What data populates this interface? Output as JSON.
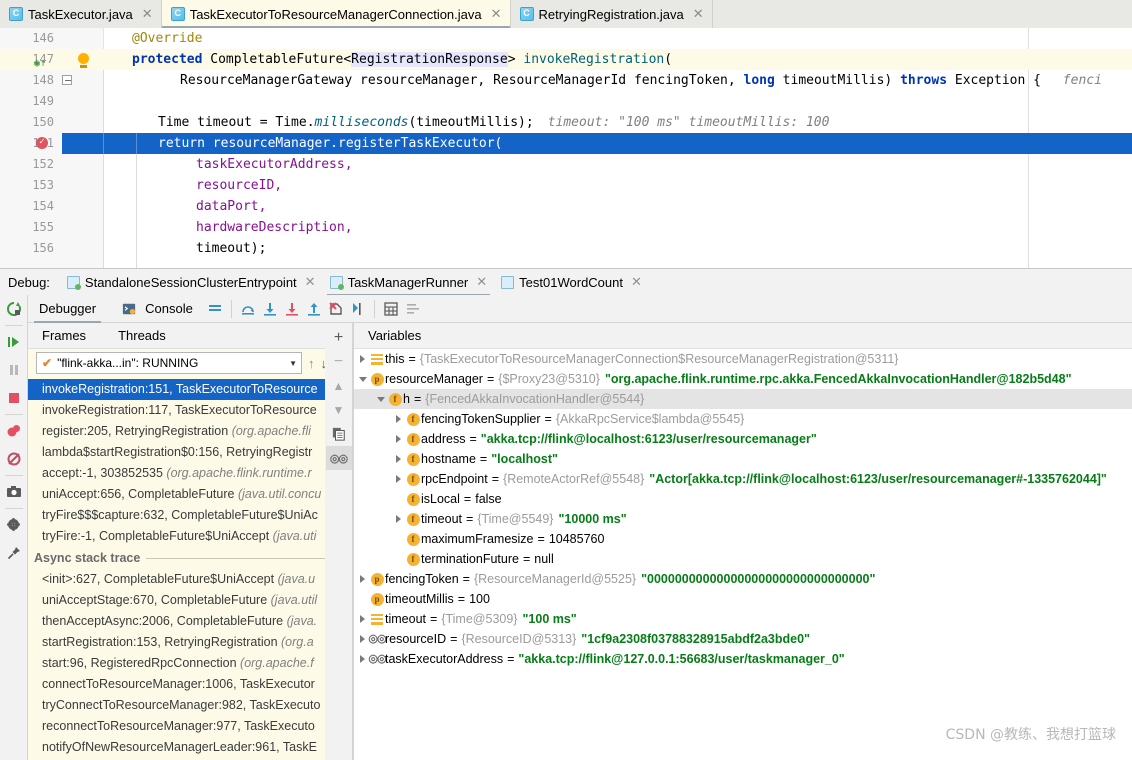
{
  "editor": {
    "tabs": [
      {
        "label": "TaskExecutor.java",
        "icon": "java-class-icon",
        "active": false,
        "close": "✕"
      },
      {
        "label": "TaskExecutorToResourceManagerConnection.java",
        "icon": "java-class-icon",
        "active": true,
        "close": "✕"
      },
      {
        "label": "RetryingRegistration.java",
        "icon": "java-class-icon",
        "active": false,
        "close": "✕"
      }
    ],
    "lines": [
      {
        "num": "146",
        "highlight": false,
        "selected": false
      },
      {
        "num": "147",
        "highlight": true,
        "selected": false
      },
      {
        "num": "148",
        "highlight": false,
        "selected": false
      },
      {
        "num": "149",
        "highlight": false,
        "selected": false
      },
      {
        "num": "150",
        "highlight": false,
        "selected": false
      },
      {
        "num": "151",
        "highlight": false,
        "selected": true
      },
      {
        "num": "152",
        "highlight": false,
        "selected": false
      },
      {
        "num": "153",
        "highlight": false,
        "selected": false
      },
      {
        "num": "154",
        "highlight": false,
        "selected": false
      },
      {
        "num": "155",
        "highlight": false,
        "selected": false
      },
      {
        "num": "156",
        "highlight": false,
        "selected": false
      }
    ],
    "code": {
      "l146_annotation": "@Override",
      "l147_kw": "protected",
      "l147_type": "CompletableFuture<",
      "l147_generic": "RegistrationResponse",
      "l147_gt": "> ",
      "l147_method": "invokeRegistration",
      "l147_paren": "(",
      "l148_p1": "ResourceManagerGateway resourceManager, ResourceManagerId fencingToken, ",
      "l148_kw": "long",
      "l148_p2": " timeoutMillis) ",
      "l148_throws": "throws",
      "l148_p3": " Exception { ",
      "l148_hint": "fenci",
      "l150_a": "Time timeout = Time.",
      "l150_m": "milliseconds",
      "l150_b": "(timeoutMillis);",
      "l150_hint": "timeout: \"100 ms\"  timeoutMillis: 100",
      "l151": "return resourceManager.registerTaskExecutor(",
      "l152": "taskExecutorAddress,",
      "l153": "resourceID,",
      "l154": "dataPort,",
      "l155": "hardwareDescription,",
      "l156": "timeout);"
    }
  },
  "debug": {
    "label": "Debug:",
    "session_tabs": [
      {
        "label": "StandaloneSessionClusterEntrypoint",
        "active": false,
        "running": true,
        "close": "✕"
      },
      {
        "label": "TaskManagerRunner",
        "active": true,
        "running": true,
        "close": "✕"
      },
      {
        "label": "Test01WordCount",
        "active": false,
        "running": false,
        "close": "✕"
      }
    ],
    "toolbar_tabs": [
      {
        "label": "Debugger",
        "icon": "debugger-icon",
        "active": true
      },
      {
        "label": "Console",
        "icon": "console-icon",
        "active": false
      }
    ],
    "rail_icons": [
      "rerun-icon",
      "resume-program-icon",
      "pause-program-icon",
      "stop-icon",
      "mute-breakpoints-icon",
      "view-breakpoints-icon",
      "camera-icon",
      "settings-icon",
      "pin-icon"
    ],
    "step_icons": [
      "layout-icon",
      "step-over-icon",
      "step-into-icon",
      "force-step-into-icon",
      "step-out-icon",
      "drop-frame-icon",
      "run-to-cursor-icon",
      "evaluate-expression-icon",
      "show-execution-point-icon"
    ]
  },
  "frames": {
    "header_tabs": [
      {
        "label": "Frames",
        "active": true
      },
      {
        "label": "Threads",
        "active": false
      }
    ],
    "thread_selector": {
      "value": "\"flink-akka...in\": RUNNING",
      "status_icon": "check-icon",
      "chevron": "▼"
    },
    "toolbar_icons": [
      "arrow-up-icon",
      "arrow-down-icon",
      "filter-icon"
    ],
    "side_icons": [
      "add-icon",
      "remove-icon",
      "move-up-icon",
      "move-down-icon",
      "copy-icon",
      "watches-icon"
    ],
    "items": [
      {
        "text": "invokeRegistration:151, TaskExecutorToResource",
        "pkg": "",
        "selected": true
      },
      {
        "text": "invokeRegistration:117, TaskExecutorToResource",
        "pkg": "",
        "selected": false
      },
      {
        "text": "register:205, RetryingRegistration ",
        "pkg": "(org.apache.fli",
        "selected": false
      },
      {
        "text": "lambda$startRegistration$0:156, RetryingRegistr",
        "pkg": "",
        "selected": false
      },
      {
        "text": "accept:-1, 303852535 ",
        "pkg": "(org.apache.flink.runtime.r",
        "selected": false
      },
      {
        "text": "uniAccept:656, CompletableFuture ",
        "pkg": "(java.util.concu",
        "selected": false
      },
      {
        "text": "tryFire$$$capture:632, CompletableFuture$UniAc",
        "pkg": "",
        "selected": false
      },
      {
        "text": "tryFire:-1, CompletableFuture$UniAccept ",
        "pkg": "(java.uti",
        "selected": false
      }
    ],
    "async_header": "Async stack trace",
    "async_items": [
      {
        "text": "<init>:627, CompletableFuture$UniAccept ",
        "pkg": "(java.u"
      },
      {
        "text": "uniAcceptStage:670, CompletableFuture ",
        "pkg": "(java.util"
      },
      {
        "text": "thenAcceptAsync:2006, CompletableFuture ",
        "pkg": "(java."
      },
      {
        "text": "startRegistration:153, RetryingRegistration ",
        "pkg": "(org.a"
      },
      {
        "text": "start:96, RegisteredRpcConnection ",
        "pkg": "(org.apache.f"
      },
      {
        "text": "connectToResourceManager:1006, TaskExecutor",
        "pkg": ""
      },
      {
        "text": "tryConnectToResourceManager:982, TaskExecuto",
        "pkg": ""
      },
      {
        "text": "reconnectToResourceManager:977, TaskExecuto",
        "pkg": ""
      },
      {
        "text": "notifyOfNewResourceManagerLeader:961, TaskE",
        "pkg": ""
      }
    ]
  },
  "variables": {
    "header": "Variables",
    "rows": [
      {
        "indent": 0,
        "arrow": "right",
        "icon": "list-badge",
        "highlight": false,
        "name": "this",
        "eq": "=",
        "type": "{TaskExecutorToResourceManagerConnection$ResourceManagerRegistration@5311}",
        "value": "",
        "value_kind": ""
      },
      {
        "indent": 0,
        "arrow": "down",
        "icon": "p-badge",
        "highlight": false,
        "name": "resourceManager",
        "eq": "=",
        "type": "{$Proxy23@5310}",
        "value": "\"org.apache.flink.runtime.rpc.akka.FencedAkkaInvocationHandler@182b5d48\"",
        "value_kind": "string"
      },
      {
        "indent": 1,
        "arrow": "down",
        "icon": "f-badge",
        "highlight": true,
        "name": "h",
        "eq": "=",
        "type": "{FencedAkkaInvocationHandler@5544}",
        "value": "",
        "value_kind": ""
      },
      {
        "indent": 2,
        "arrow": "right",
        "icon": "f-badge",
        "highlight": false,
        "name": "fencingTokenSupplier",
        "eq": "=",
        "type": "{AkkaRpcService$lambda@5545}",
        "value": "",
        "value_kind": ""
      },
      {
        "indent": 2,
        "arrow": "right",
        "icon": "f-badge",
        "highlight": false,
        "name": "address",
        "eq": "=",
        "type": "",
        "value": "\"akka.tcp://flink@localhost:6123/user/resourcemanager\"",
        "value_kind": "string"
      },
      {
        "indent": 2,
        "arrow": "right",
        "icon": "f-badge",
        "highlight": false,
        "name": "hostname",
        "eq": "=",
        "type": "",
        "value": "\"localhost\"",
        "value_kind": "string"
      },
      {
        "indent": 2,
        "arrow": "right",
        "icon": "f-badge",
        "highlight": false,
        "name": "rpcEndpoint",
        "eq": "=",
        "type": "{RemoteActorRef@5548}",
        "value": "\"Actor[akka.tcp://flink@localhost:6123/user/resourcemanager#-1335762044]\"",
        "value_kind": "string"
      },
      {
        "indent": 2,
        "arrow": "none",
        "icon": "f-badge",
        "highlight": false,
        "name": "isLocal",
        "eq": "=",
        "type": "",
        "value": "false",
        "value_kind": "keyword"
      },
      {
        "indent": 2,
        "arrow": "right",
        "icon": "f-badge",
        "highlight": false,
        "name": "timeout",
        "eq": "=",
        "type": "{Time@5549}",
        "value": "\"10000 ms\"",
        "value_kind": "string"
      },
      {
        "indent": 2,
        "arrow": "none",
        "icon": "f-badge",
        "highlight": false,
        "name": "maximumFramesize",
        "eq": "=",
        "type": "",
        "value": "10485760",
        "value_kind": "number"
      },
      {
        "indent": 2,
        "arrow": "none",
        "icon": "f-badge",
        "highlight": false,
        "name": "terminationFuture",
        "eq": "=",
        "type": "",
        "value": "null",
        "value_kind": "keyword"
      },
      {
        "indent": 0,
        "arrow": "right",
        "icon": "p-badge",
        "highlight": false,
        "name": "fencingToken",
        "eq": "=",
        "type": "{ResourceManagerId@5525}",
        "value": "\"00000000000000000000000000000000\"",
        "value_kind": "string"
      },
      {
        "indent": 0,
        "arrow": "none",
        "icon": "p-badge",
        "highlight": false,
        "name": "timeoutMillis",
        "eq": "=",
        "type": "",
        "value": "100",
        "value_kind": "number"
      },
      {
        "indent": 0,
        "arrow": "right",
        "icon": "list-badge",
        "highlight": false,
        "name": "timeout",
        "eq": "=",
        "type": "{Time@5309}",
        "value": "\"100 ms\"",
        "value_kind": "string"
      },
      {
        "indent": 0,
        "arrow": "right",
        "icon": "oo-badge",
        "highlight": false,
        "name": "resourceID",
        "eq": "=",
        "type": "{ResourceID@5313}",
        "value": "\"1cf9a2308f03788328915abdf2a3bde0\"",
        "value_kind": "string"
      },
      {
        "indent": 0,
        "arrow": "right",
        "icon": "oo-badge",
        "highlight": false,
        "name": "taskExecutorAddress",
        "eq": "=",
        "type": "",
        "value": "\"akka.tcp://flink@127.0.0.1:56683/user/taskmanager_0\"",
        "value_kind": "string"
      }
    ]
  },
  "watermark": "CSDN @教练、我想打篮球",
  "colors": {
    "selection_blue": "#1464c8",
    "tab_active": "#fdfbe8",
    "string_green": "#067d17",
    "keyword_blue": "#0033b3",
    "field_purple": "#871094",
    "method_teal": "#00627a"
  }
}
